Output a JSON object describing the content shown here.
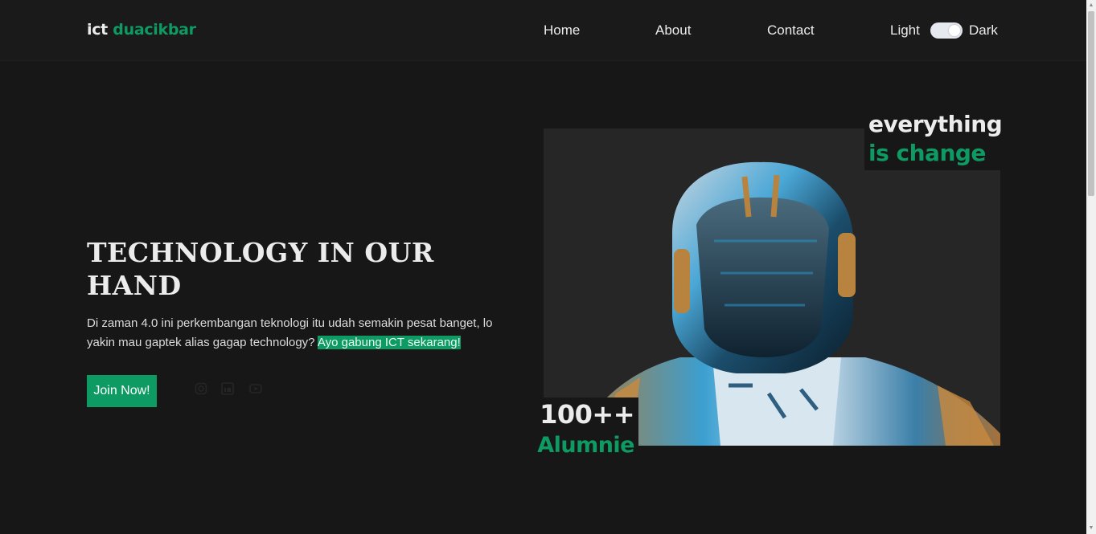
{
  "brand": {
    "part1": "ict",
    "part2": "duacikbar"
  },
  "nav": {
    "home": "Home",
    "about": "About",
    "contact": "Contact"
  },
  "theme": {
    "light": "Light",
    "dark": "Dark",
    "state": "dark"
  },
  "hero": {
    "title": "TECHNOLOGY IN OUR HAND",
    "text": "Di zaman 4.0 ini perkembangan teknologi itu udah semakin pesat banget, lo yakin mau gaptek alias gagap technology?",
    "highlight": "Ayo gabung ICT sekarang!",
    "button": "Join Now!"
  },
  "social_icons": [
    "instagram-icon",
    "linkedin-icon",
    "youtube-icon"
  ],
  "image_tags": {
    "top_line1": "everything",
    "top_line2": "is change",
    "bottom_line1": "100++",
    "bottom_line2": "Alumnie"
  },
  "colors": {
    "background": "#171717",
    "accent": "#0e9a63",
    "text": "#ececec"
  }
}
